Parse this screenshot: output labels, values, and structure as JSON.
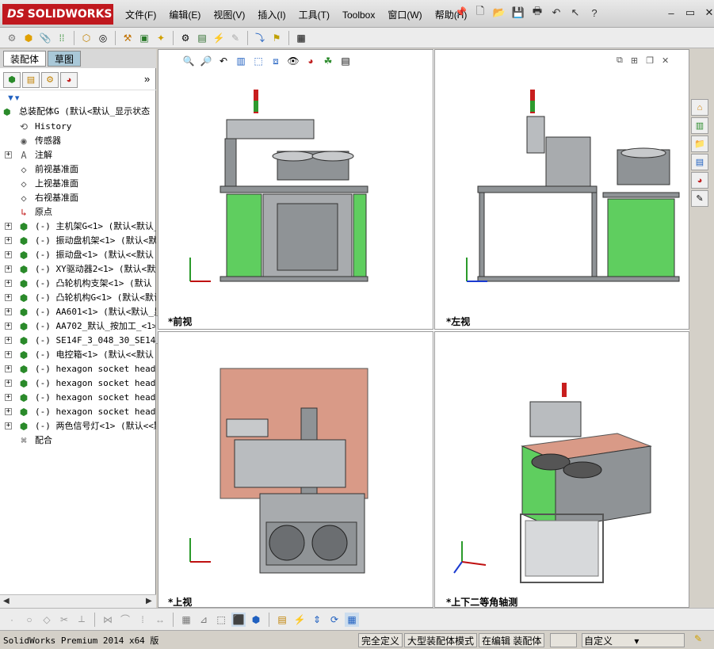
{
  "app": {
    "logo_ds": "DS",
    "logo_text": "SOLIDWORKS"
  },
  "menu": [
    "文件(F)",
    "编辑(E)",
    "视图(V)",
    "插入(I)",
    "工具(T)",
    "Toolbox",
    "窗口(W)",
    "帮助(H)"
  ],
  "tabs": [
    {
      "label": "装配体"
    },
    {
      "label": "草图"
    }
  ],
  "feature_tree": {
    "root": "总装配体G  (默认<默认_显示状态",
    "items": [
      {
        "label": "History",
        "icon": "history-icon",
        "expand": ""
      },
      {
        "label": "传感器",
        "icon": "sensor-icon",
        "expand": ""
      },
      {
        "label": "注解",
        "icon": "annotation-icon",
        "expand": "+"
      },
      {
        "label": "前视基准面",
        "icon": "plane-icon",
        "expand": ""
      },
      {
        "label": "上视基准面",
        "icon": "plane-icon",
        "expand": ""
      },
      {
        "label": "右视基准面",
        "icon": "plane-icon",
        "expand": ""
      },
      {
        "label": "原点",
        "icon": "origin-icon",
        "expand": ""
      },
      {
        "label": "(-) 主机架G<1> (默认<默认_",
        "icon": "subassembly-icon",
        "expand": "+"
      },
      {
        "label": "(-) 振动盘机架<1> (默认<默",
        "icon": "subassembly-icon",
        "expand": "+"
      },
      {
        "label": "(-) 振动盘<1> (默认<<默认",
        "icon": "subassembly-icon",
        "expand": "+"
      },
      {
        "label": "(-) XY驱动器2<1> (默认<默认",
        "icon": "subassembly-icon",
        "expand": "+"
      },
      {
        "label": "(-) 凸轮机构支架<1> (默认",
        "icon": "subassembly-icon",
        "expand": "+"
      },
      {
        "label": "(-) 凸轮机构G<1> (默认<默认",
        "icon": "subassembly-icon",
        "expand": "+"
      },
      {
        "label": "(-) AA601<1> (默认<默认_显",
        "icon": "subassembly-icon",
        "expand": "+"
      },
      {
        "label": "(-) AA702_默认_按加工_<1>",
        "icon": "subassembly-icon",
        "expand": "+"
      },
      {
        "label": "(-) SE14F_3_048_30_SE14F-3",
        "icon": "subassembly-icon",
        "expand": "+"
      },
      {
        "label": "(-) 电控箱<1> (默认<<默认",
        "icon": "subassembly-icon",
        "expand": "+"
      },
      {
        "label": "(-) hexagon socket head c",
        "icon": "subassembly-icon",
        "expand": "+"
      },
      {
        "label": "(-) hexagon socket head c",
        "icon": "subassembly-icon",
        "expand": "+"
      },
      {
        "label": "(-) hexagon socket head c",
        "icon": "subassembly-icon",
        "expand": "+"
      },
      {
        "label": "(-) hexagon socket head c",
        "icon": "subassembly-icon",
        "expand": "+"
      },
      {
        "label": "(-) 两色信号灯<1> (默认<<默",
        "icon": "subassembly-icon",
        "expand": "+"
      },
      {
        "label": "配合",
        "icon": "mates-icon",
        "expand": ""
      }
    ]
  },
  "views": {
    "front": "*前视",
    "left": "*左视",
    "top": "*上视",
    "iso": "*上下二等角轴测"
  },
  "status": {
    "product": "SolidWorks Premium 2014 x64 版",
    "defined": "完全定义",
    "mode": "大型装配体模式",
    "editing": "在编辑 装配体",
    "units": "自定义"
  },
  "colors": {
    "green": "#5fce5f",
    "salmon": "#d99a87",
    "frame": "#8f9396",
    "dark": "#5a5d60",
    "red_light": "#c81e1e"
  }
}
